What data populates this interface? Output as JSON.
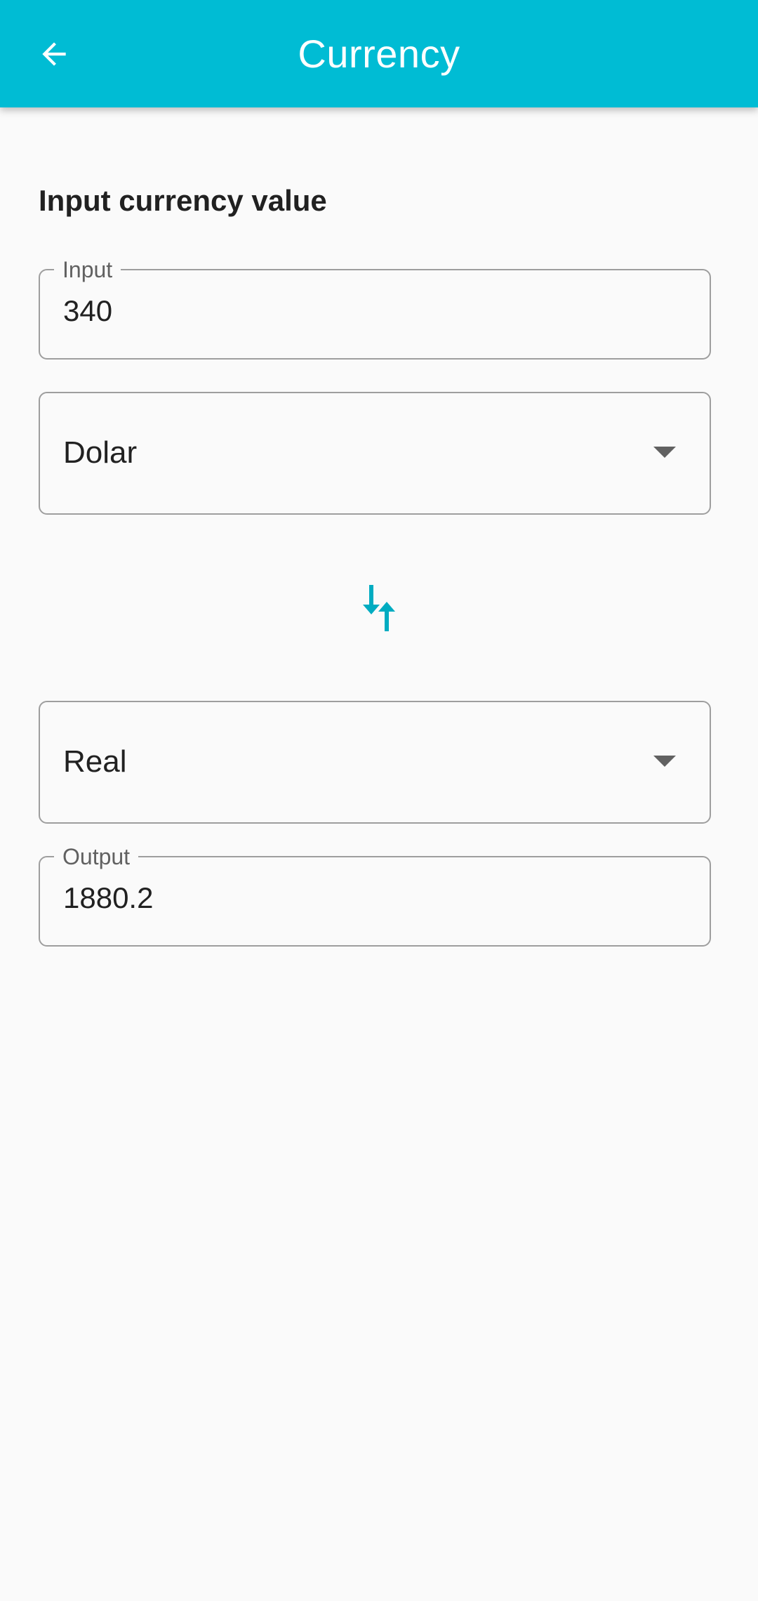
{
  "app_bar": {
    "title": "Currency",
    "back_icon": "arrow-back-icon",
    "color": "#00bcd4"
  },
  "form": {
    "section_title": "Input currency value",
    "input": {
      "label": "Input",
      "value": "340"
    },
    "from_currency": {
      "selected": "Dolar"
    },
    "swap_icon": "swap-vert-icon",
    "swap_color": "#00acc1",
    "to_currency": {
      "selected": "Real"
    },
    "output": {
      "label": "Output",
      "value": "1880.2"
    }
  }
}
